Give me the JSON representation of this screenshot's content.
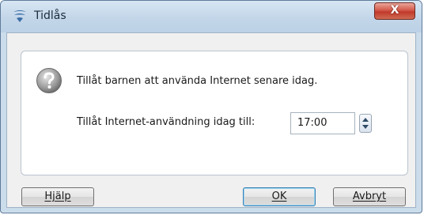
{
  "window": {
    "title": "Tidlås",
    "close_symbol": "X"
  },
  "dialog": {
    "icon": "question-icon",
    "question": "Tillåt barnen att använda Internet senare idag.",
    "time_label": "Tillåt Internet-användning idag till:",
    "time_value": "17:00"
  },
  "buttons": {
    "help": "Hjälp",
    "ok": "OK",
    "cancel": "Avbryt"
  },
  "colors": {
    "titlebar": "#c3d6e9",
    "close_button": "#c0392b",
    "ok_border": "#3c7fb1"
  }
}
